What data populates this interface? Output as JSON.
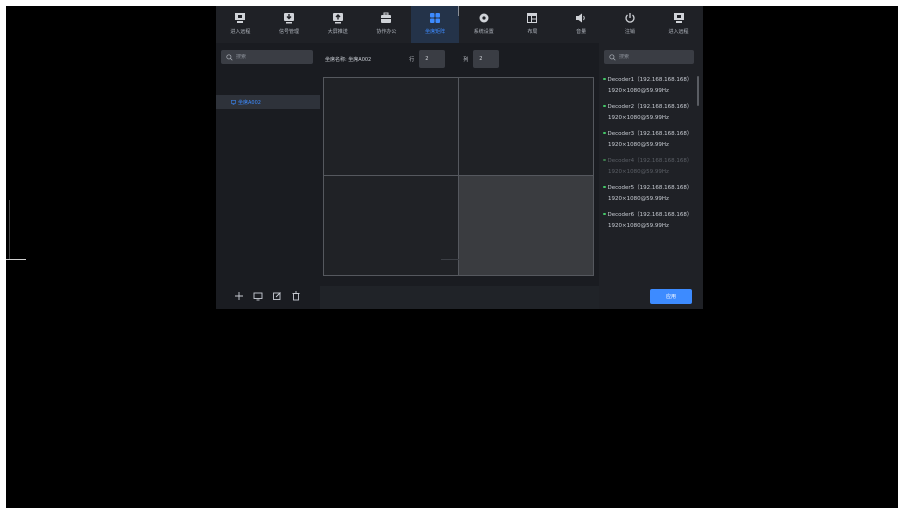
{
  "nav": {
    "items": [
      {
        "label": "进入远程",
        "icon": "remote-enter-icon",
        "active": false
      },
      {
        "label": "信号管理",
        "icon": "signal-download-icon",
        "active": false
      },
      {
        "label": "大屏推送",
        "icon": "screen-push-icon",
        "active": false
      },
      {
        "label": "协作办公",
        "icon": "briefcase-icon",
        "active": false
      },
      {
        "label": "坐席矩阵",
        "icon": "grid-matrix-icon",
        "active": true
      },
      {
        "label": "系统设置",
        "icon": "gear-icon",
        "active": false
      },
      {
        "label": "布局",
        "icon": "layout-icon",
        "active": false
      },
      {
        "label": "音量",
        "icon": "volume-icon",
        "active": false
      },
      {
        "label": "注销",
        "icon": "power-icon",
        "active": false
      },
      {
        "label": "进入远程",
        "icon": "remote-enter-icon",
        "active": false
      }
    ]
  },
  "sidebar": {
    "search_placeholder": "搜索",
    "screen_item": "坐席A002"
  },
  "main": {
    "screen_name_label": "坐席名称: 坐席A002",
    "row_label": "行",
    "row_value": "2",
    "col_label": "列",
    "col_value": "2"
  },
  "right": {
    "search_placeholder": "搜索",
    "decoders": [
      {
        "name": "Decoder1（192.168.168.168）",
        "res": "1920×1080@59.99Hz",
        "dim": false
      },
      {
        "name": "Decoder2（192.168.168.168）",
        "res": "1920×1080@59.99Hz",
        "dim": false
      },
      {
        "name": "Decoder3（192.168.168.168）",
        "res": "1920×1080@59.99Hz",
        "dim": false
      },
      {
        "name": "Decoder4（192.168.168.168）",
        "res": "1920×1080@59.99Hz",
        "dim": true
      },
      {
        "name": "Decoder5（192.168.168.168）",
        "res": "1920×1080@59.99Hz",
        "dim": false
      },
      {
        "name": "Decoder6（192.168.168.168）",
        "res": "1920×1080@59.99Hz",
        "dim": false
      }
    ],
    "apply_label": "应用"
  },
  "colors": {
    "accent": "#3d8bff",
    "online": "#44c767",
    "panel": "#1a1c21"
  }
}
